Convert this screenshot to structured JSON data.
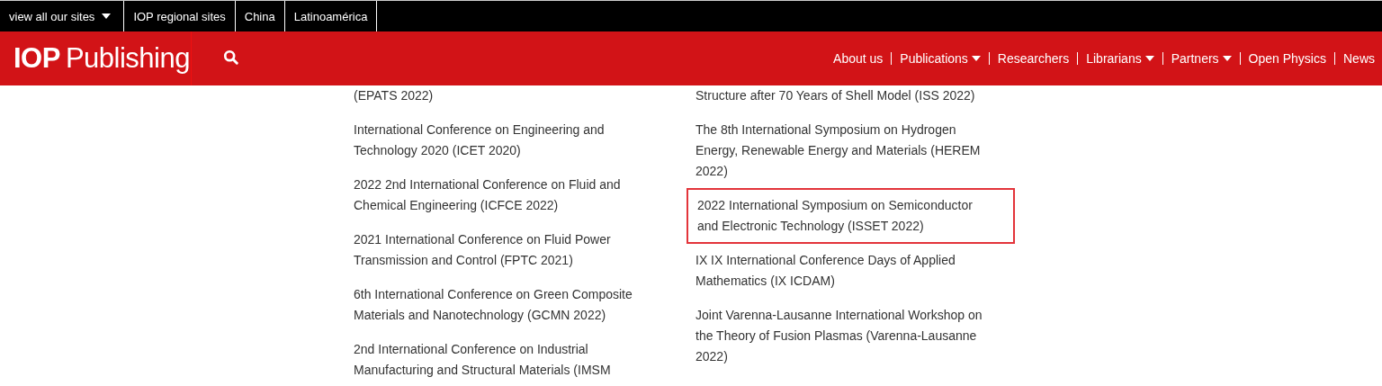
{
  "top_bar": {
    "sites_menu": "view all our sites",
    "links": [
      "IOP regional sites",
      "China",
      "Latinoamérica"
    ]
  },
  "header": {
    "logo_bold": "IOP",
    "logo_text": "Publishing",
    "nav": [
      {
        "label": "About us",
        "has_menu": false
      },
      {
        "label": "Publications",
        "has_menu": true
      },
      {
        "label": "Researchers",
        "has_menu": false
      },
      {
        "label": "Librarians",
        "has_menu": true
      },
      {
        "label": "Partners",
        "has_menu": true
      },
      {
        "label": "Open Physics",
        "has_menu": false
      },
      {
        "label": "News",
        "has_menu": false
      }
    ]
  },
  "columns": [
    {
      "items": [
        {
          "lines": [
            "(EPATS 2022)"
          ],
          "highlighted": false
        },
        {
          "lines": [
            "International Conference on Engineering and",
            "Technology 2020 (ICET 2020)"
          ],
          "highlighted": false
        },
        {
          "lines": [
            "2022 2nd International Conference on Fluid and",
            "Chemical Engineering (ICFCE 2022)"
          ],
          "highlighted": false
        },
        {
          "lines": [
            "2021 International Conference on Fluid Power",
            "Transmission and Control (FPTC 2021)"
          ],
          "highlighted": false
        },
        {
          "lines": [
            "6th International Conference on Green Composite",
            "Materials and Nanotechnology (GCMN 2022)"
          ],
          "highlighted": false
        },
        {
          "lines": [
            "2nd International Conference on Industrial",
            "Manufacturing and Structural Materials (IMSM"
          ],
          "highlighted": false
        }
      ]
    },
    {
      "items": [
        {
          "lines": [
            "Structure after 70 Years of Shell Model (ISS 2022)"
          ],
          "highlighted": false
        },
        {
          "lines": [
            "The 8th International Symposium on Hydrogen",
            "Energy, Renewable Energy and Materials (HEREM",
            "2022)"
          ],
          "highlighted": false
        },
        {
          "lines": [
            "2022 International Symposium on Semiconductor",
            "and Electronic Technology (ISSET 2022)"
          ],
          "highlighted": true
        },
        {
          "lines": [
            "IX IX International Conference Days of Applied",
            "Mathematics (IX ICDAM)"
          ],
          "highlighted": false
        },
        {
          "lines": [
            "Joint Varenna-Lausanne International Workshop on",
            "the Theory of Fusion Plasmas (Varenna-Lausanne",
            "2022)"
          ],
          "highlighted": false
        }
      ]
    }
  ]
}
